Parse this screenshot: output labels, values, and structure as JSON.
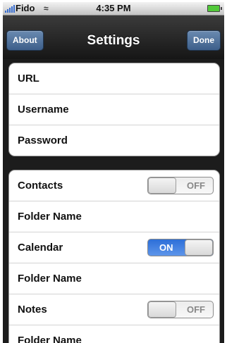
{
  "status_bar": {
    "carrier": "Fido",
    "time": "4:35 PM"
  },
  "nav": {
    "title": "Settings",
    "left_button": "About",
    "right_button": "Done"
  },
  "account_group": {
    "rows": [
      {
        "label": "URL"
      },
      {
        "label": "Username"
      },
      {
        "label": "Password"
      }
    ]
  },
  "sync_group": {
    "rows": [
      {
        "label": "Contacts",
        "toggle": "OFF"
      },
      {
        "label": "Folder Name"
      },
      {
        "label": "Calendar",
        "toggle": "ON"
      },
      {
        "label": "Folder Name"
      },
      {
        "label": "Notes",
        "toggle": "OFF"
      },
      {
        "label": "Folder Name"
      }
    ]
  },
  "colors": {
    "nav_button": "#4a6c96",
    "toggle_on": "#3b7ee0"
  }
}
